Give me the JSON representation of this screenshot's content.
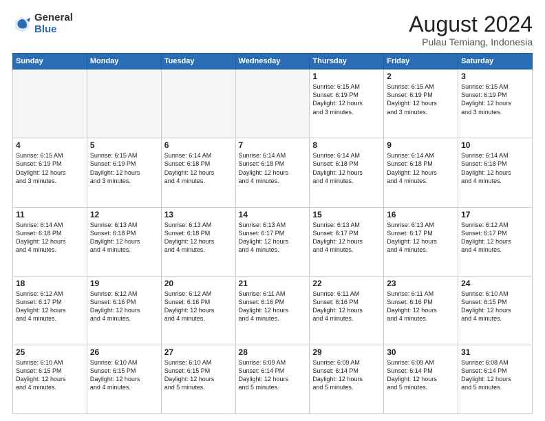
{
  "logo": {
    "general": "General",
    "blue": "Blue"
  },
  "header": {
    "title": "August 2024",
    "subtitle": "Pulau Temiang, Indonesia"
  },
  "weekdays": [
    "Sunday",
    "Monday",
    "Tuesday",
    "Wednesday",
    "Thursday",
    "Friday",
    "Saturday"
  ],
  "weeks": [
    [
      {
        "day": "",
        "info": ""
      },
      {
        "day": "",
        "info": ""
      },
      {
        "day": "",
        "info": ""
      },
      {
        "day": "",
        "info": ""
      },
      {
        "day": "1",
        "info": "Sunrise: 6:15 AM\nSunset: 6:19 PM\nDaylight: 12 hours\nand 3 minutes."
      },
      {
        "day": "2",
        "info": "Sunrise: 6:15 AM\nSunset: 6:19 PM\nDaylight: 12 hours\nand 3 minutes."
      },
      {
        "day": "3",
        "info": "Sunrise: 6:15 AM\nSunset: 6:19 PM\nDaylight: 12 hours\nand 3 minutes."
      }
    ],
    [
      {
        "day": "4",
        "info": "Sunrise: 6:15 AM\nSunset: 6:19 PM\nDaylight: 12 hours\nand 3 minutes."
      },
      {
        "day": "5",
        "info": "Sunrise: 6:15 AM\nSunset: 6:19 PM\nDaylight: 12 hours\nand 3 minutes."
      },
      {
        "day": "6",
        "info": "Sunrise: 6:14 AM\nSunset: 6:18 PM\nDaylight: 12 hours\nand 4 minutes."
      },
      {
        "day": "7",
        "info": "Sunrise: 6:14 AM\nSunset: 6:18 PM\nDaylight: 12 hours\nand 4 minutes."
      },
      {
        "day": "8",
        "info": "Sunrise: 6:14 AM\nSunset: 6:18 PM\nDaylight: 12 hours\nand 4 minutes."
      },
      {
        "day": "9",
        "info": "Sunrise: 6:14 AM\nSunset: 6:18 PM\nDaylight: 12 hours\nand 4 minutes."
      },
      {
        "day": "10",
        "info": "Sunrise: 6:14 AM\nSunset: 6:18 PM\nDaylight: 12 hours\nand 4 minutes."
      }
    ],
    [
      {
        "day": "11",
        "info": "Sunrise: 6:14 AM\nSunset: 6:18 PM\nDaylight: 12 hours\nand 4 minutes."
      },
      {
        "day": "12",
        "info": "Sunrise: 6:13 AM\nSunset: 6:18 PM\nDaylight: 12 hours\nand 4 minutes."
      },
      {
        "day": "13",
        "info": "Sunrise: 6:13 AM\nSunset: 6:18 PM\nDaylight: 12 hours\nand 4 minutes."
      },
      {
        "day": "14",
        "info": "Sunrise: 6:13 AM\nSunset: 6:17 PM\nDaylight: 12 hours\nand 4 minutes."
      },
      {
        "day": "15",
        "info": "Sunrise: 6:13 AM\nSunset: 6:17 PM\nDaylight: 12 hours\nand 4 minutes."
      },
      {
        "day": "16",
        "info": "Sunrise: 6:13 AM\nSunset: 6:17 PM\nDaylight: 12 hours\nand 4 minutes."
      },
      {
        "day": "17",
        "info": "Sunrise: 6:12 AM\nSunset: 6:17 PM\nDaylight: 12 hours\nand 4 minutes."
      }
    ],
    [
      {
        "day": "18",
        "info": "Sunrise: 6:12 AM\nSunset: 6:17 PM\nDaylight: 12 hours\nand 4 minutes."
      },
      {
        "day": "19",
        "info": "Sunrise: 6:12 AM\nSunset: 6:16 PM\nDaylight: 12 hours\nand 4 minutes."
      },
      {
        "day": "20",
        "info": "Sunrise: 6:12 AM\nSunset: 6:16 PM\nDaylight: 12 hours\nand 4 minutes."
      },
      {
        "day": "21",
        "info": "Sunrise: 6:11 AM\nSunset: 6:16 PM\nDaylight: 12 hours\nand 4 minutes."
      },
      {
        "day": "22",
        "info": "Sunrise: 6:11 AM\nSunset: 6:16 PM\nDaylight: 12 hours\nand 4 minutes."
      },
      {
        "day": "23",
        "info": "Sunrise: 6:11 AM\nSunset: 6:16 PM\nDaylight: 12 hours\nand 4 minutes."
      },
      {
        "day": "24",
        "info": "Sunrise: 6:10 AM\nSunset: 6:15 PM\nDaylight: 12 hours\nand 4 minutes."
      }
    ],
    [
      {
        "day": "25",
        "info": "Sunrise: 6:10 AM\nSunset: 6:15 PM\nDaylight: 12 hours\nand 4 minutes."
      },
      {
        "day": "26",
        "info": "Sunrise: 6:10 AM\nSunset: 6:15 PM\nDaylight: 12 hours\nand 4 minutes."
      },
      {
        "day": "27",
        "info": "Sunrise: 6:10 AM\nSunset: 6:15 PM\nDaylight: 12 hours\nand 5 minutes."
      },
      {
        "day": "28",
        "info": "Sunrise: 6:09 AM\nSunset: 6:14 PM\nDaylight: 12 hours\nand 5 minutes."
      },
      {
        "day": "29",
        "info": "Sunrise: 6:09 AM\nSunset: 6:14 PM\nDaylight: 12 hours\nand 5 minutes."
      },
      {
        "day": "30",
        "info": "Sunrise: 6:09 AM\nSunset: 6:14 PM\nDaylight: 12 hours\nand 5 minutes."
      },
      {
        "day": "31",
        "info": "Sunrise: 6:08 AM\nSunset: 6:14 PM\nDaylight: 12 hours\nand 5 minutes."
      }
    ]
  ]
}
